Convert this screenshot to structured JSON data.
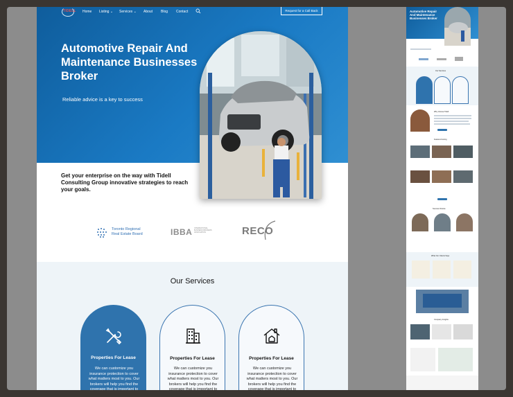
{
  "nav": {
    "logo_text": "TIDELL",
    "items": [
      "Home",
      "Listing",
      "Services",
      "About",
      "Blog",
      "Contact"
    ],
    "cta": "Request for a Call Back"
  },
  "hero": {
    "title": "Automotive Repair And Maintenance Businesses Broker",
    "subtitle": "Reliable advice is a key to success",
    "tagline": "Get your enterprise on the way with Tidell Consulting Group innovative strategies to reach your goals."
  },
  "partners": {
    "treb_line1": "Toronto Regional",
    "treb_line2": "Real Estate Board",
    "ibba": "IBBA",
    "ibba_small": "INTERNATIONAL BUSINESS BROKERS ASSOCIATION",
    "reco": "RECO"
  },
  "services": {
    "title": "Our Services",
    "cards": [
      {
        "title": "Properties For Lease",
        "desc": "We can customize you insurance protection to cover what matters most to you. Our brokers will help you find the coverage that is important to you",
        "icon": "tools-icon",
        "active": true
      },
      {
        "title": "Properties For Lease",
        "desc": "We can customize you insurance protection to cover what matters most to you. Our brokers will help you find the coverage that is important to you and your family.",
        "icon": "building-icon",
        "active": false
      },
      {
        "title": "Properties For Lease",
        "desc": "We can customize you insurance protection to cover what matters most to you. Our brokers will help you find the coverage that is important to you and your family.",
        "icon": "house-icon",
        "active": false
      }
    ]
  },
  "thumbnail": {
    "title": "Automotive Repair And Maintenance Businesses Broker",
    "services_title": "Our Services",
    "why_title": "Why choose Tidell",
    "featured_title": "Featured Listing",
    "partners_title": "Success Stories",
    "what_clients_say": "What Our Clients Says",
    "insights_title": "Company Insights"
  },
  "colors": {
    "brand_blue": "#1a7ac4",
    "card_blue": "#2f73ad",
    "section_bg": "#eef4f8"
  }
}
